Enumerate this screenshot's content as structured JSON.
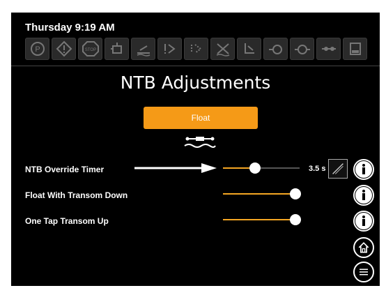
{
  "header": {
    "datetime": "Thursday 9:19 AM",
    "icons": [
      "parking-icon",
      "warning-icon",
      "stop-icon",
      "engine-icon",
      "trim-level-icon",
      "trim-alert-icon",
      "trim-limit-icon",
      "no-trim-icon",
      "transom-icon",
      "oil-pressure-icon",
      "oil-temp-icon",
      "trim-gauge-icon",
      "fuel-icon"
    ]
  },
  "title": "NTB Adjustments",
  "float_button": {
    "label": "Float"
  },
  "rows": [
    {
      "label": "NTB Override Timer",
      "slider_value": 0.42,
      "value_text": "3.5 s"
    },
    {
      "label": "Float With Transom Down",
      "slider_value": 1.0
    },
    {
      "label": "One Tap Transom Up",
      "slider_value": 1.0
    }
  ],
  "colors": {
    "accent": "#f59a17",
    "background": "#000000",
    "text": "#ffffff"
  }
}
